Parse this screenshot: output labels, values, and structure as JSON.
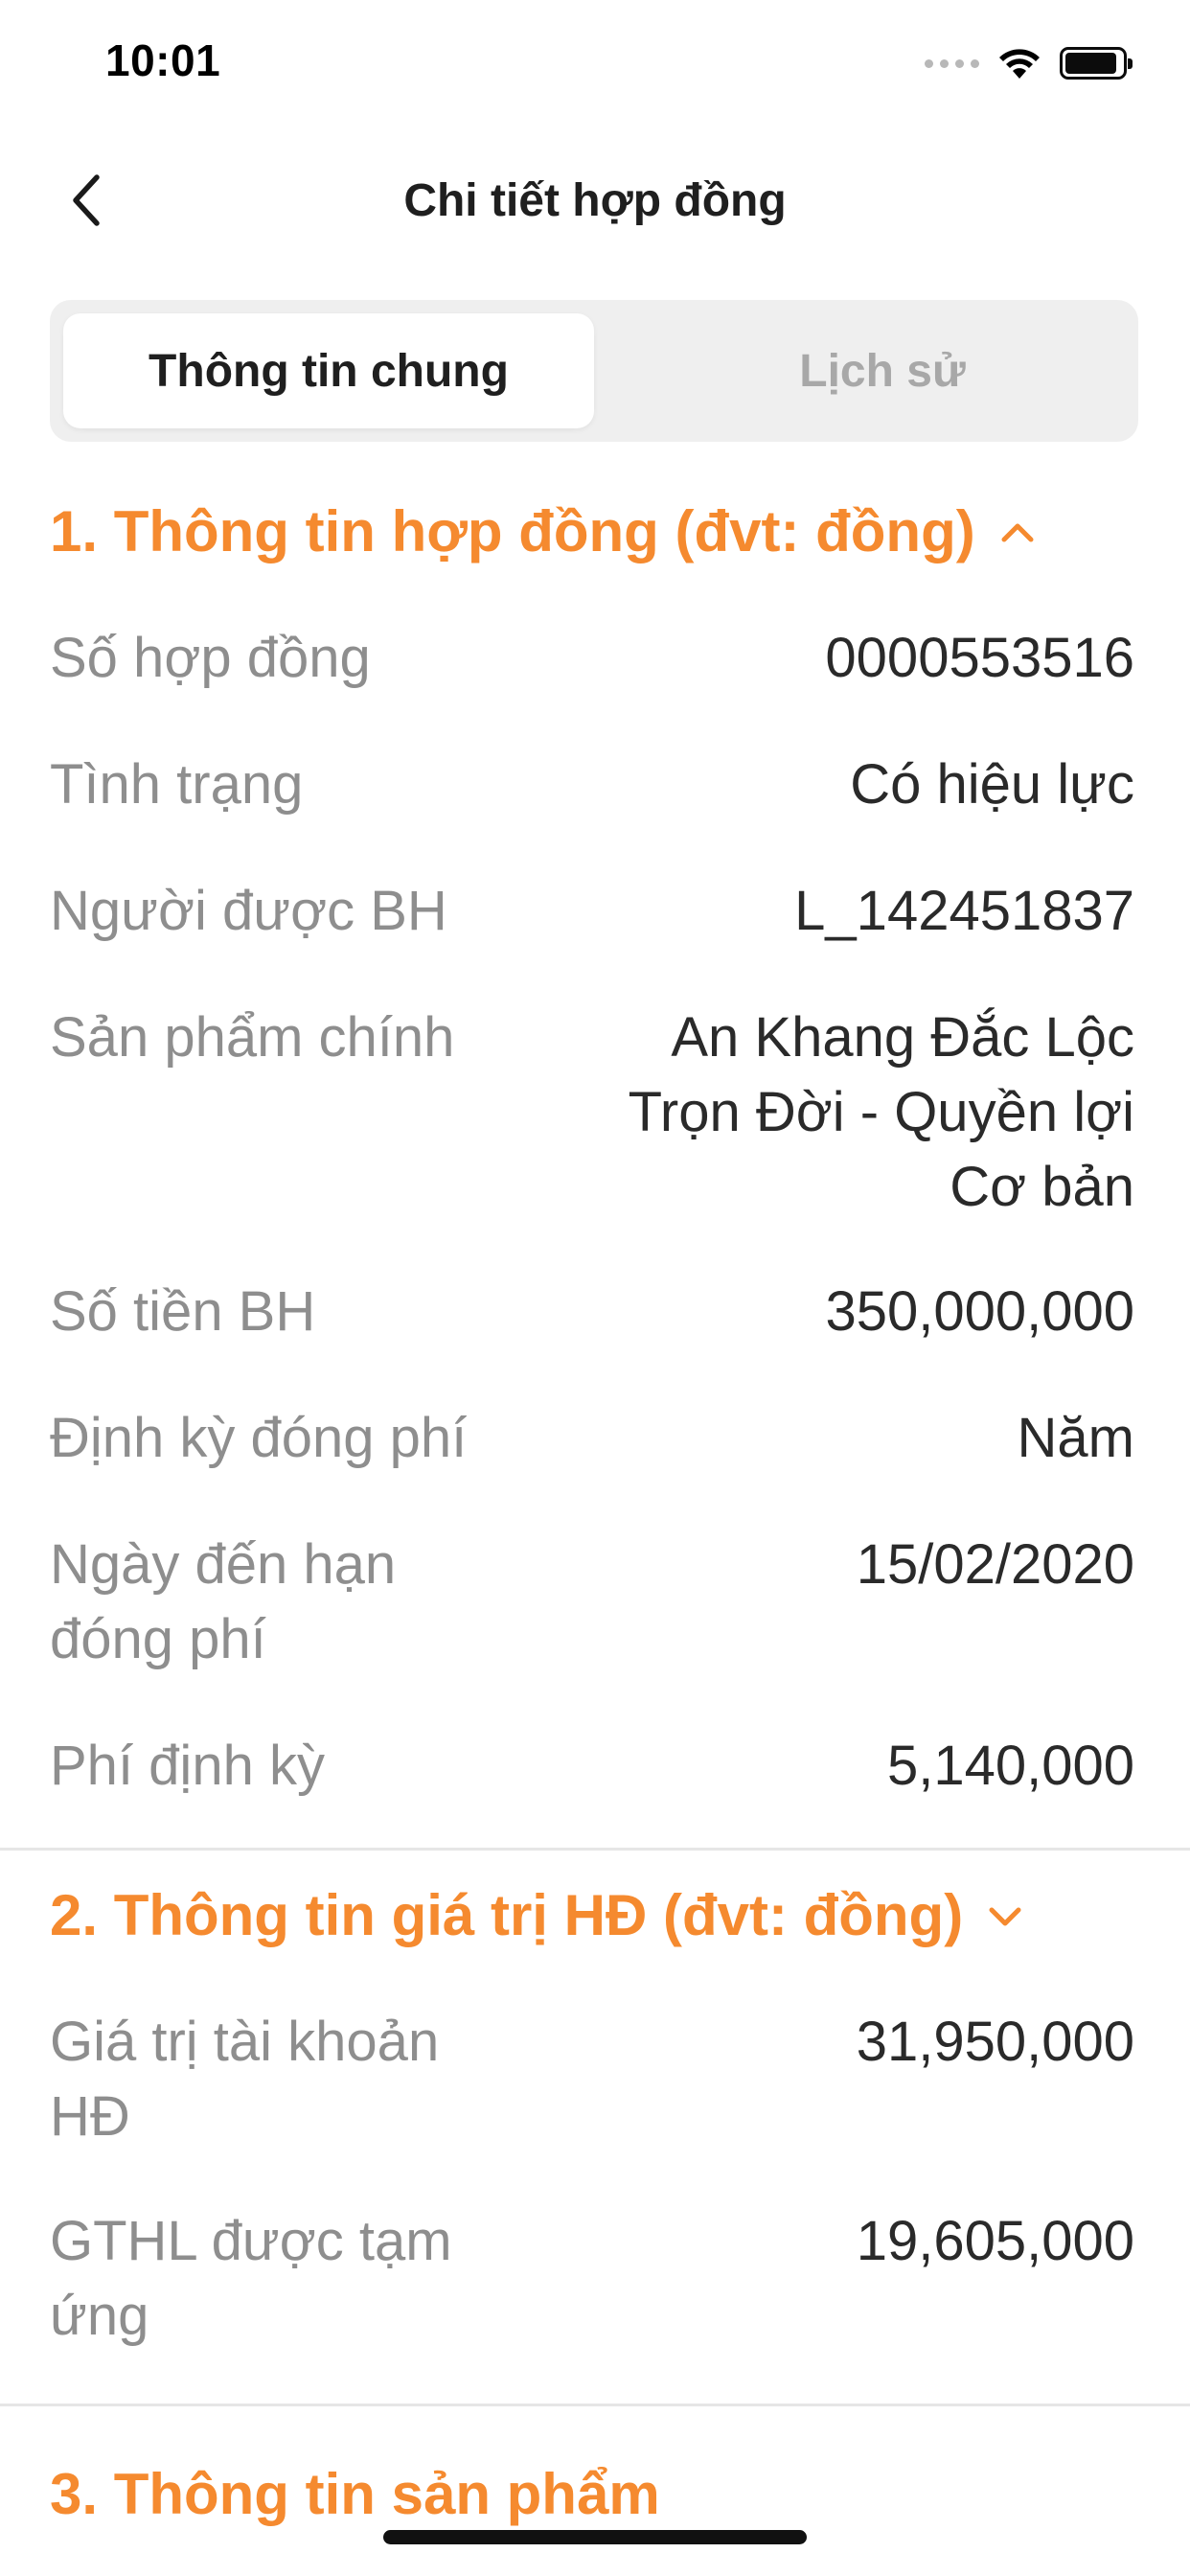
{
  "status_bar": {
    "time": "10:01",
    "icons": [
      "signal-dots-icon",
      "wifi-icon",
      "battery-icon"
    ]
  },
  "nav": {
    "back_icon": "chevron-left-icon",
    "title": "Chi tiết hợp đồng"
  },
  "tabs": [
    {
      "label": "Thông tin chung",
      "selected": true
    },
    {
      "label": "Lịch sử",
      "selected": false
    }
  ],
  "sections": [
    {
      "title": "1. Thông tin hợp đồng (đvt: đồng)",
      "expanded": true,
      "chevron_icon": "chevron-up-icon",
      "rows": [
        {
          "label": "Số hợp đồng",
          "value": "0000553516"
        },
        {
          "label": "Tình trạng",
          "value": "Có hiệu lực"
        },
        {
          "label": "Người được BH",
          "value": "L_142451837"
        },
        {
          "label": "Sản phẩm chính",
          "value": "An Khang Đắc Lộc Trọn Đời - Quyền lợi Cơ bản"
        },
        {
          "label": "Số tiền BH",
          "value": "350,000,000"
        },
        {
          "label": "Định kỳ đóng phí",
          "value": "Năm"
        },
        {
          "label": "Ngày đến hạn đóng phí",
          "value": "15/02/2020"
        },
        {
          "label": "Phí định kỳ",
          "value": "5,140,000"
        }
      ]
    },
    {
      "title": "2. Thông tin giá trị HĐ (đvt: đồng)",
      "expanded": true,
      "chevron_icon": "chevron-down-icon",
      "rows": [
        {
          "label": "Giá trị tài khoản HĐ",
          "value": "31,950,000"
        },
        {
          "label": "GTHL được tạm ứng",
          "value": "19,605,000"
        }
      ]
    },
    {
      "title": "3. Thông tin sản phẩm"
    }
  ],
  "colors": {
    "accent": "#f58a2f",
    "label": "#8e8e8e",
    "value": "#2a2a2a",
    "segment_bg": "#efefef"
  }
}
